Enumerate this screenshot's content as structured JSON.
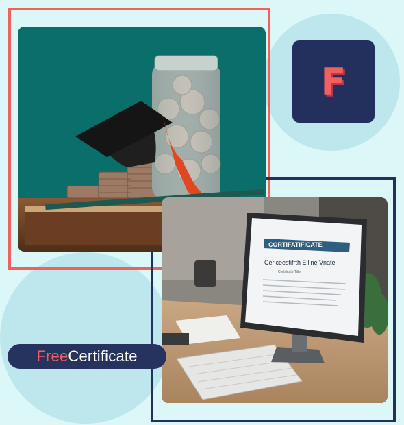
{
  "logo": {
    "letter": "F"
  },
  "brand": {
    "part1": "Free",
    "part2": "Certificate"
  },
  "screen": {
    "banner": "CORTIFATIFICATE",
    "title": "Cericeestifrth Elline Vnate",
    "subtitle": "Certificate Title"
  },
  "colors": {
    "accent": "#f25f5f",
    "navy": "#23305e",
    "teal": "#0a6f6b",
    "circle": "#bde7ec",
    "background": "#dcf7f8"
  }
}
